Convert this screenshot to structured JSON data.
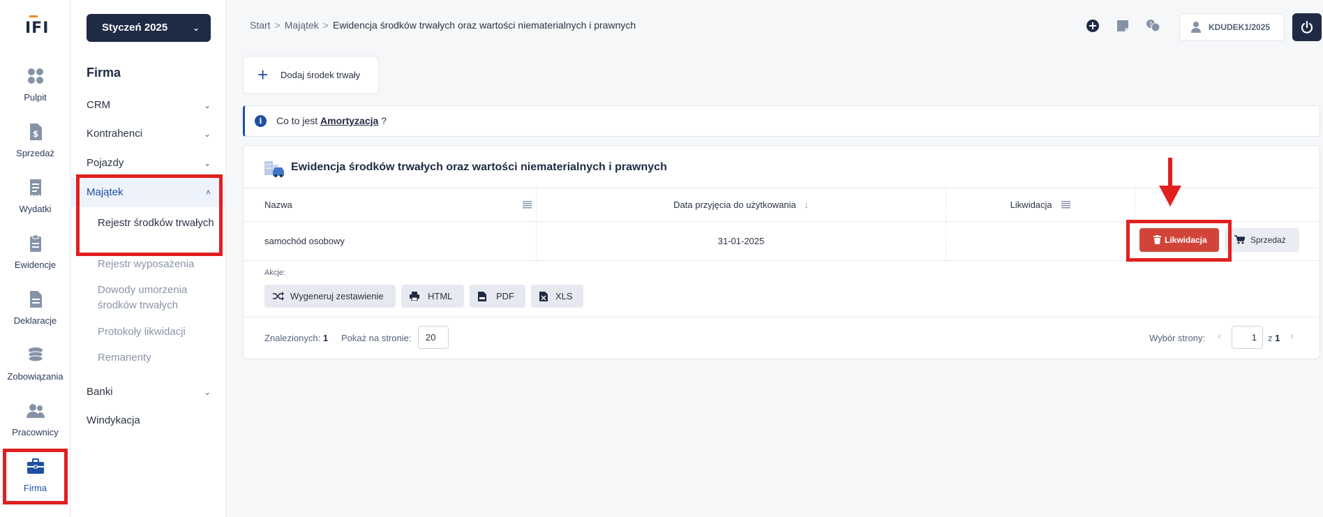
{
  "app": {
    "logo_text": "IFI"
  },
  "rail": {
    "items": [
      {
        "label": "Pulpit",
        "icon": "dashboard-icon"
      },
      {
        "label": "Sprzedaż",
        "icon": "invoice-dollar-icon"
      },
      {
        "label": "Wydatki",
        "icon": "receipt-icon"
      },
      {
        "label": "Ewidencje",
        "icon": "clipboard-icon"
      },
      {
        "label": "Deklaracje",
        "icon": "document-icon"
      },
      {
        "label": "Zobowiązania",
        "icon": "coins-icon"
      },
      {
        "label": "Pracownicy",
        "icon": "users-icon"
      },
      {
        "label": "Firma",
        "icon": "briefcase-icon",
        "active": true
      }
    ]
  },
  "sidebar": {
    "period": "Styczeń 2025",
    "title": "Firma",
    "items": [
      {
        "label": "CRM"
      },
      {
        "label": "Kontrahenci"
      },
      {
        "label": "Pojazdy"
      },
      {
        "label": "Majątek"
      },
      {
        "label": "Banki"
      },
      {
        "label": "Windykacja"
      }
    ],
    "sub_items": [
      {
        "label": "Rejestr środków trwałych"
      },
      {
        "label": "Rejestr wyposażenia"
      },
      {
        "label": "Dowody umorzenia środków trwałych"
      },
      {
        "label": "Protokoły likwidacji"
      },
      {
        "label": "Remanenty"
      }
    ]
  },
  "header": {
    "breadcrumbs": [
      "Start",
      "Majątek",
      "Ewidencja środków trwałych oraz wartości niematerialnych i prawnych"
    ],
    "user": "KDUDEK1/2025"
  },
  "main": {
    "add_button": "Dodaj środek trwały",
    "info_prefix": "Co to jest",
    "info_link": "Amortyzacja",
    "info_suffix": "?",
    "panel_title": "Ewidencja środków trwałych oraz wartości niematerialnych i prawnych",
    "columns": [
      "Nazwa",
      "Data przyjęcia do użytkowania",
      "Likwidacja"
    ],
    "rows": [
      {
        "name": "samochód osobowy",
        "date": "31-01-2025",
        "liquidation": ""
      }
    ],
    "row_buttons": {
      "liquidate": "Likwidacja",
      "sell": "Sprzedaż"
    },
    "actions_label": "Akcje:",
    "actions": [
      "Wygeneruj zestawienie",
      "HTML",
      "PDF",
      "XLS"
    ],
    "found_label": "Znalezionych:",
    "found_count": "1",
    "per_page_label": "Pokaż na stronie:",
    "per_page": "20",
    "page_label": "Wybór strony:",
    "page_current": "1",
    "page_of": "z",
    "page_total": "1"
  },
  "colors": {
    "accent": "#1e4fa3",
    "dark": "#1f2a44",
    "danger": "#d2443a",
    "annotation": "#e01f1f"
  }
}
